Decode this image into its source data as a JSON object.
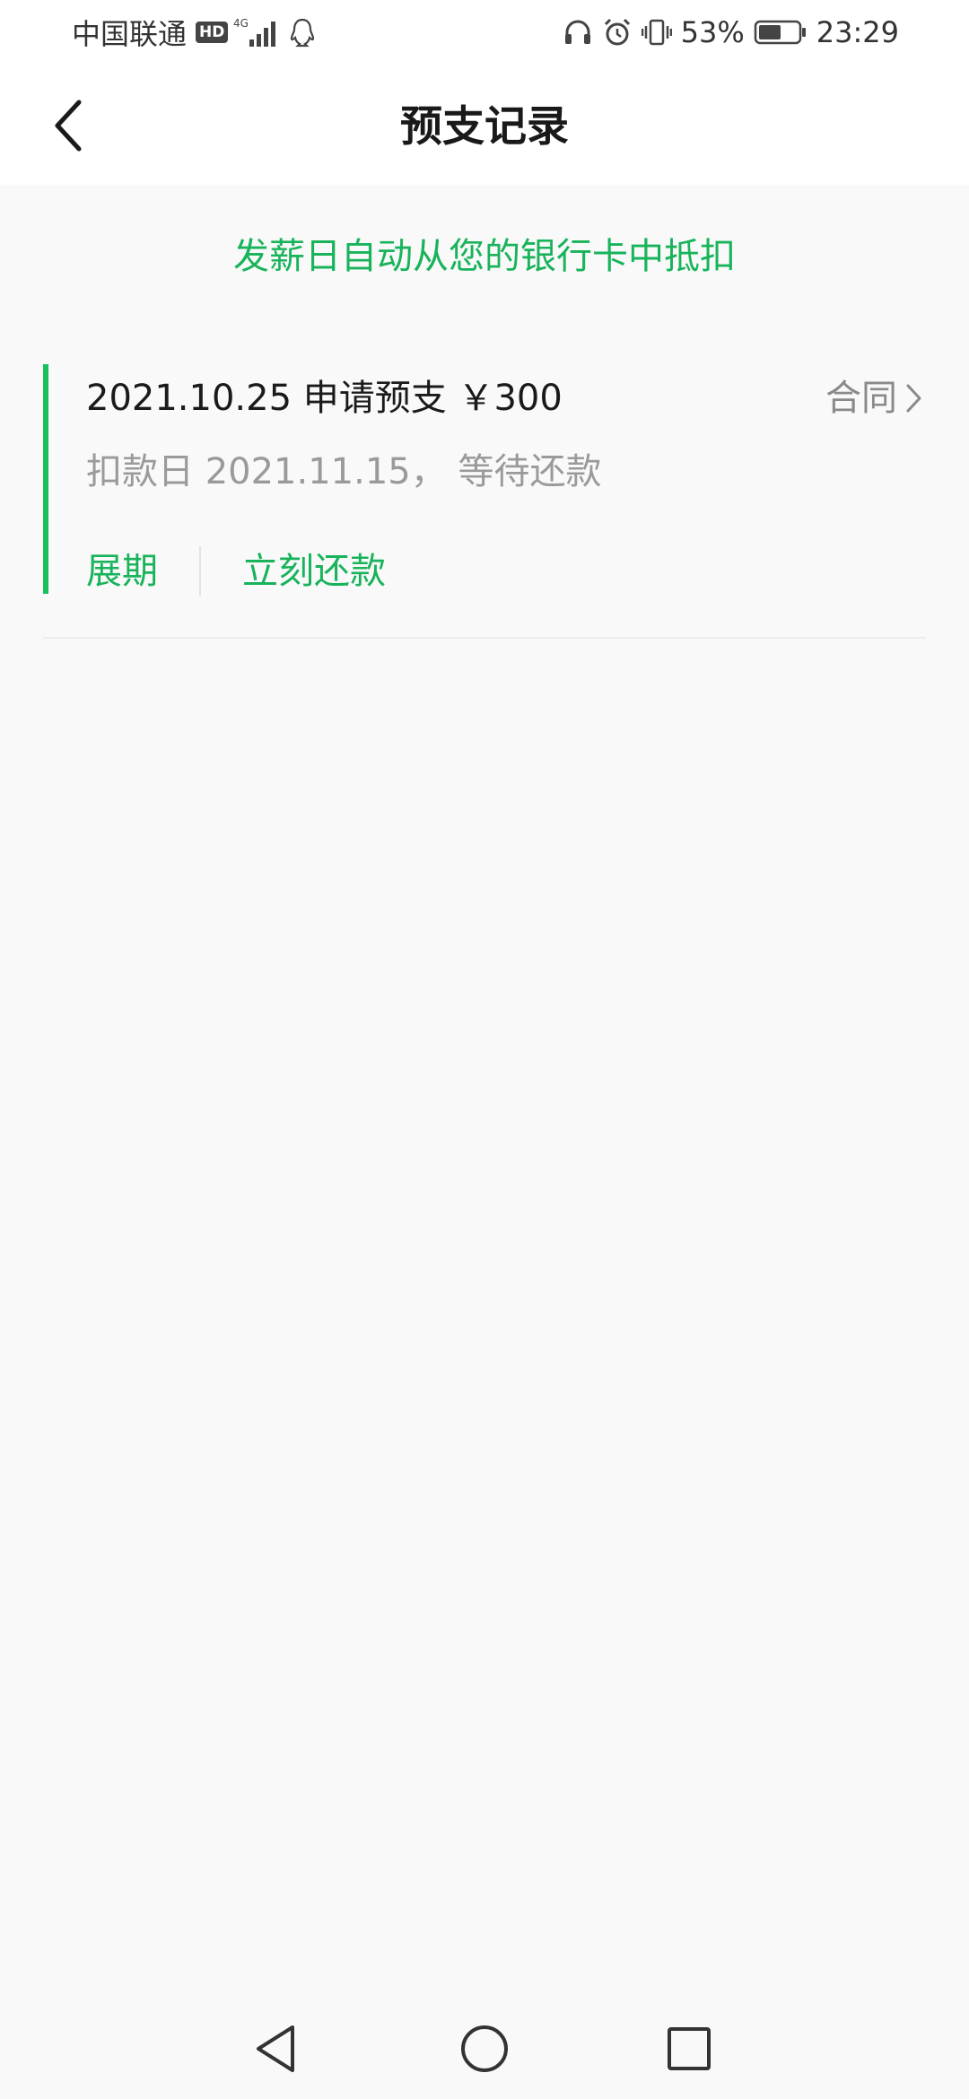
{
  "status_bar": {
    "carrier": "中国联通",
    "hd_badge": "HD",
    "network": "4G",
    "battery_percent": "53%",
    "time": "23:29"
  },
  "nav": {
    "title": "预支记录"
  },
  "notice": "发薪日自动从您的银行卡中抵扣",
  "records": [
    {
      "title": "2021.10.25 申请预支 ￥300",
      "contract_label": "合同",
      "subtitle": "扣款日 2021.11.15， 等待还款",
      "action_extend": "展期",
      "action_repay": "立刻还款"
    }
  ],
  "colors": {
    "accent_green": "#18b35a",
    "accent_bar": "#19c05c",
    "page_background": "#f9f9f9"
  },
  "icons": {
    "back": "chevron-left-icon",
    "contract_arrow": "chevron-right-icon",
    "nav_back": "triangle-back-icon",
    "nav_home": "circle-home-icon",
    "nav_recents": "square-recents-icon"
  }
}
